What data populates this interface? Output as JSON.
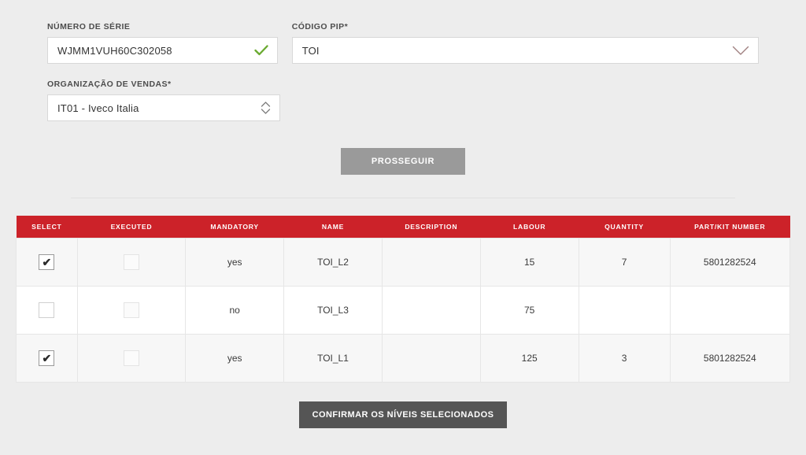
{
  "form": {
    "serial": {
      "label": "NÚMERO DE SÉRIE",
      "value": "WJMM1VUH60C302058",
      "placeholder": "",
      "valid_icon": "check-icon",
      "valid_color": "#6aaa30"
    },
    "pip": {
      "label": "CÓDIGO PIP*",
      "value": "TOI",
      "placeholder": "",
      "dropdown_icon": "chevron-down-icon",
      "dropdown_color": "#a08181"
    },
    "salesorg": {
      "label": "ORGANIZAÇÃO DE VENDAS*",
      "value": "IT01 - Iveco Italia",
      "placeholder": "",
      "stepper_icon": "chevron-up-down-icon",
      "stepper_color": "#7c7c7c"
    },
    "proceed_label": "PROSSEGUIR",
    "proceed_color": "#9a9a9a"
  },
  "table": {
    "header_color": "#cc2229",
    "columns": [
      "SELECT",
      "EXECUTED",
      "MANDATORY",
      "NAME",
      "DESCRIPTION",
      "LABOUR",
      "QUANTITY",
      "PART/KIT NUMBER"
    ],
    "rows": [
      {
        "select": true,
        "executed": false,
        "mandatory": "yes",
        "name": "TOI_L2",
        "description": "",
        "labour": "15",
        "quantity": "7",
        "part_kit_number": "5801282524"
      },
      {
        "select": false,
        "executed": false,
        "mandatory": "no",
        "name": "TOI_L3",
        "description": "",
        "labour": "75",
        "quantity": "",
        "part_kit_number": ""
      },
      {
        "select": true,
        "executed": false,
        "mandatory": "yes",
        "name": "TOI_L1",
        "description": "",
        "labour": "125",
        "quantity": "3",
        "part_kit_number": "5801282524"
      }
    ]
  },
  "footer": {
    "confirm_label": "CONFIRMAR OS NÍVEIS SELECIONADOS",
    "confirm_color": "#555555"
  }
}
